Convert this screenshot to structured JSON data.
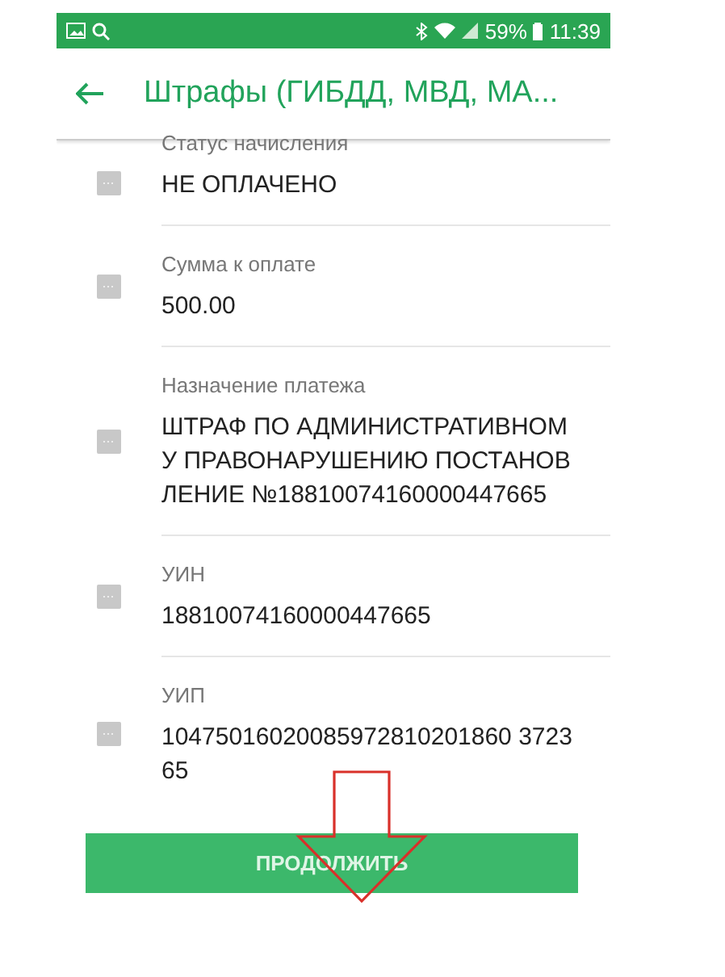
{
  "status_bar": {
    "battery": "59%",
    "time": "11:39"
  },
  "header": {
    "title": "Штрафы (ГИБДД, МВД, МА..."
  },
  "fields": [
    {
      "label": "Статус начисления",
      "value": "НЕ ОПЛАЧЕНО"
    },
    {
      "label": "Сумма к оплате",
      "value": "500.00"
    },
    {
      "label": "Назначение платежа",
      "value": "ШТРАФ ПО АДМИНИСТРАТИВНОМУ ПРАВОНАРУШЕНИЮ ПОСТАНОВЛЕНИЕ №18810074160000447665"
    },
    {
      "label": "УИН",
      "value": "18810074160000447665"
    },
    {
      "label": "УИП",
      "value": "10475016020085972810201860 372365"
    }
  ],
  "button": "ПРОДОЛЖИТЬ"
}
